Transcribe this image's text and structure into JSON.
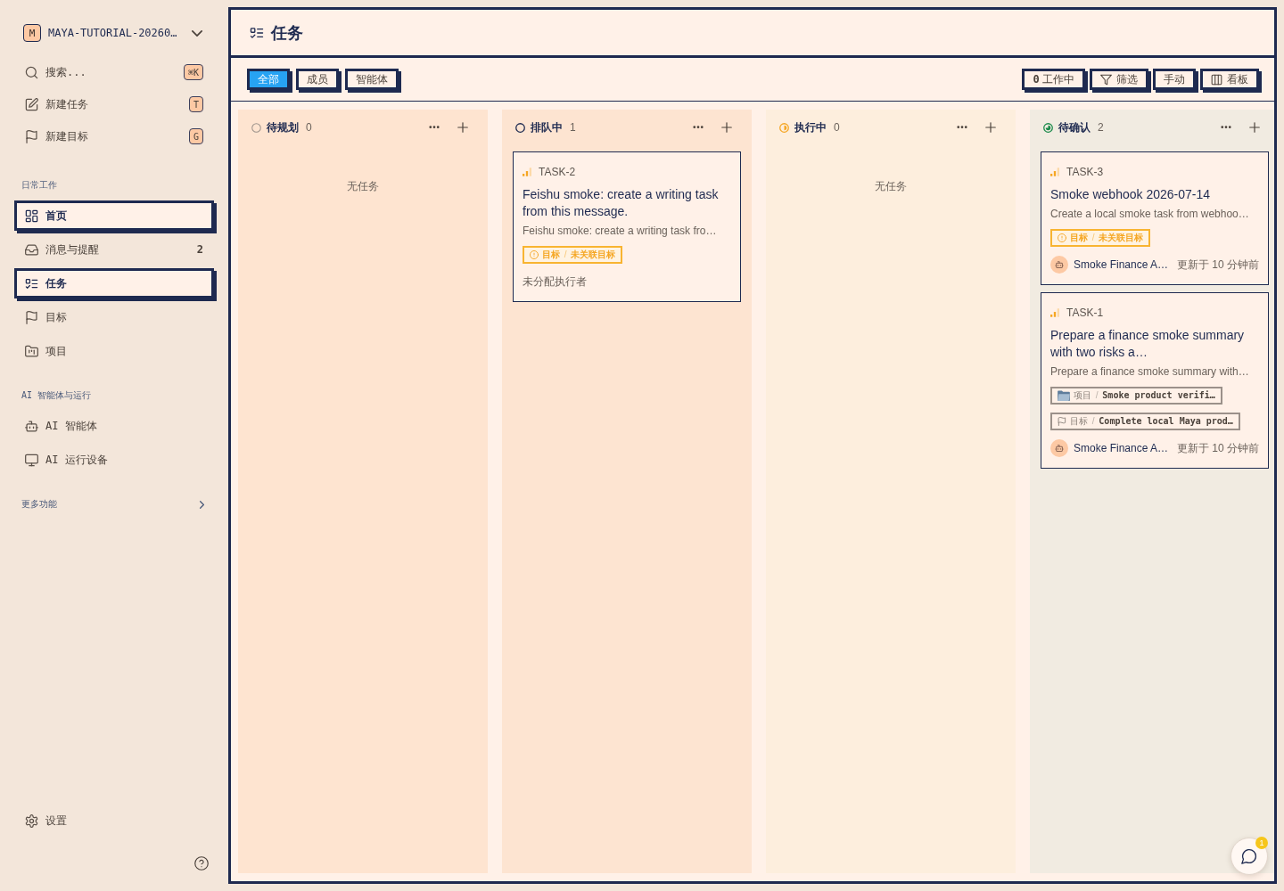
{
  "sidebar": {
    "workspace": {
      "initial": "M",
      "name": "MAYA-TUTORIAL-20260…"
    },
    "quick_actions": [
      {
        "kind": "search",
        "label": "搜索...",
        "shortcut": "⌘K"
      },
      {
        "kind": "newtask",
        "label": "新建任务",
        "shortcut": "T"
      },
      {
        "kind": "newgoal",
        "label": "新建目标",
        "shortcut": "G"
      }
    ],
    "sections": [
      {
        "title": "日常工作",
        "items": [
          {
            "kind": "home",
            "label": "首页",
            "selected": true
          },
          {
            "kind": "inbox",
            "label": "消息与提醒",
            "count": "2",
            "selected": false
          },
          {
            "kind": "tasks",
            "label": "任务",
            "selected": true
          },
          {
            "kind": "goals",
            "label": "目标",
            "selected": false
          },
          {
            "kind": "projects",
            "label": "项目",
            "selected": false
          }
        ]
      },
      {
        "title": "AI 智能体与运行",
        "items": [
          {
            "kind": "agents",
            "label": "AI 智能体",
            "selected": false
          },
          {
            "kind": "devices",
            "label": "AI 运行设备",
            "selected": false
          }
        ]
      }
    ],
    "more": {
      "label": "更多功能",
      "expanded": false
    },
    "settings": {
      "label": "设置"
    }
  },
  "header": {
    "title": "任务"
  },
  "toolbar": {
    "tabs": [
      {
        "label": "全部",
        "selected": true
      },
      {
        "label": "成员",
        "selected": false
      },
      {
        "label": "智能体",
        "selected": false
      }
    ],
    "actions": [
      {
        "kind": "working",
        "label": "**0** 工作中"
      },
      {
        "kind": "filter",
        "label": "筛选"
      },
      {
        "kind": "sort",
        "label": "手动"
      },
      {
        "kind": "view",
        "label": "看板"
      }
    ]
  },
  "columns": [
    {
      "kind": "backlog",
      "title": "待规划",
      "count": "0",
      "empty_text": "无任务"
    },
    {
      "kind": "todo",
      "title": "排队中",
      "count": "1",
      "cards": [
        {
          "id": "TASK-2",
          "title": "Feishu smoke: create a writing task from this message.",
          "description": "Feishu smoke: create a writing task fro…",
          "tags": [
            {
              "kind": "goal",
              "warning": true,
              "label": "目标",
              "separator": "/",
              "value": "未关联目标"
            }
          ],
          "assignee": {
            "kind": "none",
            "text": "未分配执行者"
          }
        }
      ]
    },
    {
      "kind": "inprogress",
      "title": "执行中",
      "count": "0",
      "empty_text": "无任务"
    },
    {
      "kind": "review",
      "title": "待确认",
      "count": "2",
      "cards": [
        {
          "id": "TASK-3",
          "title": "Smoke webhook 2026-07-14",
          "description": "Create a local smoke task from webhoo…",
          "tags": [
            {
              "kind": "goal",
              "warning": true,
              "label": "目标",
              "separator": "/",
              "value": "未关联目标"
            }
          ],
          "assignee": {
            "kind": "agent",
            "name": "Smoke Finance A…",
            "updated": "更新于 10 分钟前"
          }
        },
        {
          "id": "TASK-1",
          "title": "Prepare a finance smoke summary with two risks a…",
          "description": "Prepare a finance smoke summary with…",
          "tags": [
            {
              "kind": "project",
              "warning": false,
              "label": "项目",
              "separator": "/",
              "value": "Smoke product verifi…"
            },
            {
              "kind": "goal",
              "warning": false,
              "label": "目标",
              "separator": "/",
              "value": "Complete local Maya prod…"
            }
          ],
          "assignee": {
            "kind": "agent",
            "name": "Smoke Finance A…",
            "updated": "更新于 10 分钟前"
          }
        }
      ]
    }
  ],
  "chat": {
    "unread": "1"
  }
}
